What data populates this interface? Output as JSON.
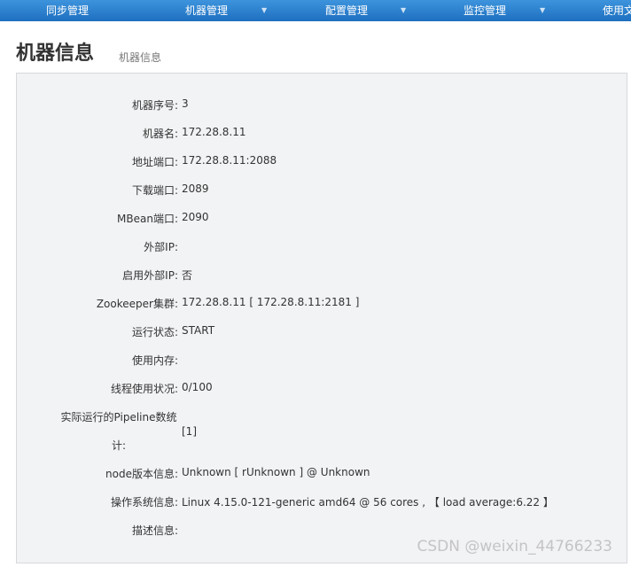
{
  "nav": {
    "items": [
      {
        "label": "同步管理"
      },
      {
        "label": "机器管理"
      },
      {
        "label": "配置管理"
      },
      {
        "label": "监控管理"
      },
      {
        "label": "使用文"
      }
    ]
  },
  "header": {
    "title": "机器信息",
    "subtitle": "机器信息"
  },
  "info": {
    "rows": [
      {
        "label": "机器序号:",
        "value": "3"
      },
      {
        "label": "机器名:",
        "value": "172.28.8.11"
      },
      {
        "label": "地址端口:",
        "value": "172.28.8.11:2088"
      },
      {
        "label": "下载端口:",
        "value": "2089"
      },
      {
        "label": "MBean端口:",
        "value": "2090"
      },
      {
        "label": "外部IP:",
        "value": ""
      },
      {
        "label": "启用外部IP:",
        "value": "否"
      },
      {
        "label": "Zookeeper集群:",
        "value": "172.28.8.11 [ 172.28.8.11:2181 ]"
      },
      {
        "label": "运行状态:",
        "value": "START"
      },
      {
        "label": "使用内存:",
        "value": ""
      },
      {
        "label": "线程使用状况:",
        "value": "0/100"
      },
      {
        "label_line1": "实际运行的Pipeline数统",
        "label_line2": "计:",
        "value": "[1]"
      },
      {
        "label": "node版本信息:",
        "value": "Unknown [ rUnknown ] @ Unknown"
      },
      {
        "label": "操作系统信息:",
        "value": "Linux 4.15.0-121-generic amd64 @ 56 cores , 【 load average:6.22 】"
      },
      {
        "label": "描述信息:",
        "value": ""
      }
    ]
  },
  "watermark": "CSDN @weixin_44766233"
}
